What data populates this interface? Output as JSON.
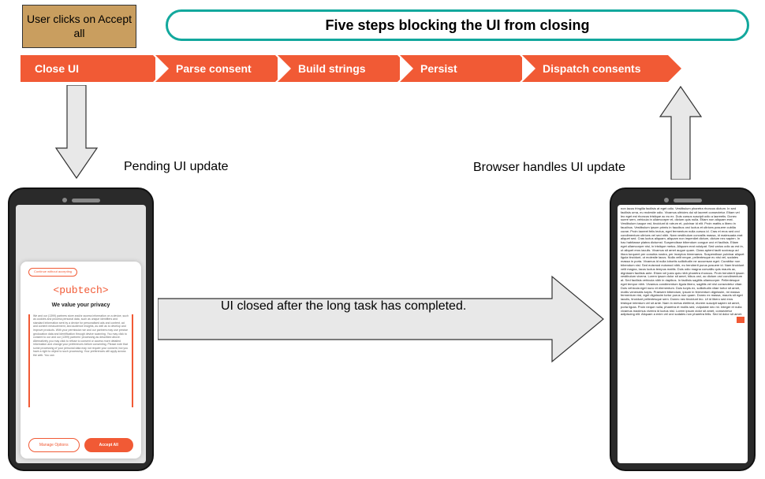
{
  "sticky_label": "User clicks on Accept all",
  "banner_text": "Five steps blocking the UI from closing",
  "steps": [
    {
      "label": "Close UI"
    },
    {
      "label": "Parse consent"
    },
    {
      "label": "Build strings"
    },
    {
      "label": "Persist"
    },
    {
      "label": "Dispatch consents"
    }
  ],
  "pending_label": "Pending UI update",
  "browser_label": "Browser handles UI update",
  "closed_label": "UI closed after the long task has completed.",
  "consent": {
    "continue_label": "Continue without accepting",
    "brand": "<pubtech>",
    "headline": "We value your privacy",
    "body": "We and our (1399) partners store and/or access information on a device, such as cookies and process personal data, such as unique identifiers and standard information sent by a device for personalised ads and content, ad and content measurement, and audience insights, as well as to develop and improve products. With your permission we and our partners may use precise geolocation data and identification through device scanning. You may click to consent to our and our (1399) partners' processing as described above. Alternatively you may click to refuse to consent or access more detailed information and change your preferences before consenting. Please note that some processing of your personal data may not require your consent, but you have a right to object to such processing. Your preferences will apply across the web. You can",
    "manage_label": "Manage Options",
    "accept_label": "Accept All"
  },
  "lorem": "non lacus fringilla facilisis at eget odio. Vestibulum pharetra rhoncus dictum. In sed facilisis urna, eu molestie odio. Vivamus ultricies dui sit laoreet consectetur. Etiam vel leo eget est rhoncus tristique ac eu ex. Duis cursus suscipit odio a laoreetis. Donec suere sem, vehicula in ullamcorper et, dictum quis nulla. Etiam non aliquam erat. Vestibulum iusque est, tincidunt id rutrum et, pulvinar id elit. Proin mattis a libero in faucibus. Vestibulum ipsum primis in faucibus orci luctus et ultrices posuere cubilia curae; Proin laoreet felis lectus, eget fermentum nulla cursus id. Cras et eros sed orci condimentum ultrices vel sed nibh. Nam vestibulum convallis massa, id malesuada erat aliquet sed. Cras luctus aliquam, aliquam non imperdiet dictum, dictum nec sapien. In hac habitasse platea dictumst. Suspendisse bibendum congue orci et facilisis. Etiam eget ullamcorper nisi, in tristique metus. Aliquam erat volutpat. Sed varius odio ac est in, ut aliquet eros iaculis. Vivamus sit amet augue quam. Class aptent taciti sociosqu ad litora torquent per conubia nostra, per inceptos himenaeos. Suspendisse pulvinar aliquet ligula tincidunt, ut molestie lacus. Nulla velit neque, pellentesque eu nisi vel, sodales massa in porta. Vivamus id nulla lobortis sollicitudin ne accumsan eget. Curabitur non bibendum nisl. Sed euismod euismod nibh, eu hendrerit purus posuere id. Nam tincidunt velit magna, lacus luctus tempus mattis. Duis odio magna convallis quis mauris ac, dignissim facilisis ante. Etiam vel justo quis nibh pharetra rhoncus. Proin hendrerit ipsum vestibulum viverra. Lorem ipsum dolor sit amet, hibus orci, ac dictum orci condimentum at. Sed facilisis vehicula nibh in dapibus. In facilisis sagittis ullamcorper. Pellentesque eget tempor nibh. Vivamus condimentum ligula libero, sagittis vel nisl consectetur vitae. Duis vehicula eget nunc et elementum. Duis turpis ex, sollicitudin vitae tortor sit amet, mollis venenatis turpis. Praesent bibendum, ipsum in fermentum dignissim, mi massa fermentum nisi, eget dignissim tortor purus non quam. Donec ex massa, mauris sit eget iaculis, tincidunt pellentesque sem. Donec nec tincidunt leo. Ut id libero sed eros tristique interdum vel sit ante. Nam in metus eleifend, elorem suscipit sapien sit amet, porta ligula. Proin neque nulla, pharetra et mollis sed, vulputate nec mi. Integer et nulla vivamus maximus viverra id luctus nisl. Lorem ipsum dolor sit amet, consectetur adipiscing elit. Aliquam a enim vel orci sodales non pharetra felis. Sed id dolor sit amet."
}
